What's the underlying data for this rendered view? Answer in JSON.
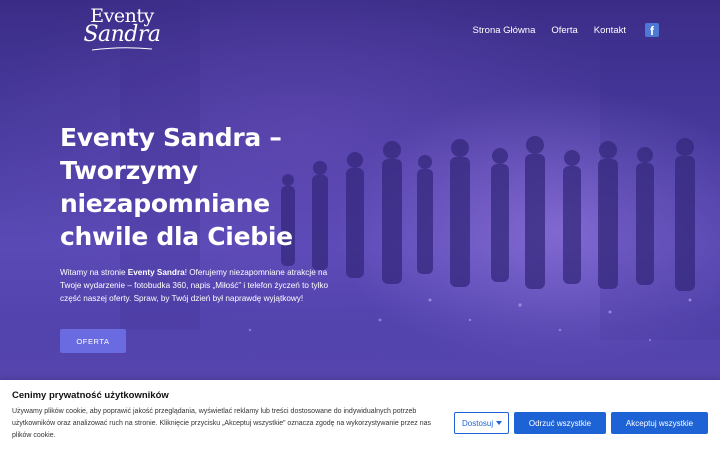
{
  "header": {
    "logo_line1": "Eventy",
    "logo_line2": "Sandra",
    "nav": [
      "Strona Główna",
      "Oferta",
      "Kontakt"
    ],
    "social_icon": "facebook-icon"
  },
  "hero": {
    "headline": "Eventy Sandra – Tworzymy niezapomniane chwile dla Ciebie",
    "intro_before": "Witamy na stronie ",
    "intro_brand": "Eventy Sandra",
    "intro_after": "! Oferujemy niezapomniane atrakcje na Twoje wydarzenie – fotobudka 360, napis „Miłość” i telefon życzeń to tylko część naszej oferty. Spraw, by Twój dzień był naprawdę wyjątkowy!",
    "cta_label": "OFERTA"
  },
  "cookie": {
    "title": "Cenimy prywatność użytkowników",
    "text": "Używamy plików cookie, aby poprawić jakość przeglądania, wyświetlać reklamy lub treści dostosowane do indywidualnych potrzeb użytkowników oraz analizować ruch na stronie. Kliknięcie przycisku „Akceptuj wszystkie” oznacza zgodę na wykorzystywanie przez nas plików cookie.",
    "customize_label": "Dostosuj",
    "reject_label": "Odrzuć wszystkie",
    "accept_label": "Akceptuj wszystkie"
  },
  "colors": {
    "accent": "#6a6be0",
    "cookie_button": "#1e63d6",
    "facebook": "#4e78d6"
  }
}
